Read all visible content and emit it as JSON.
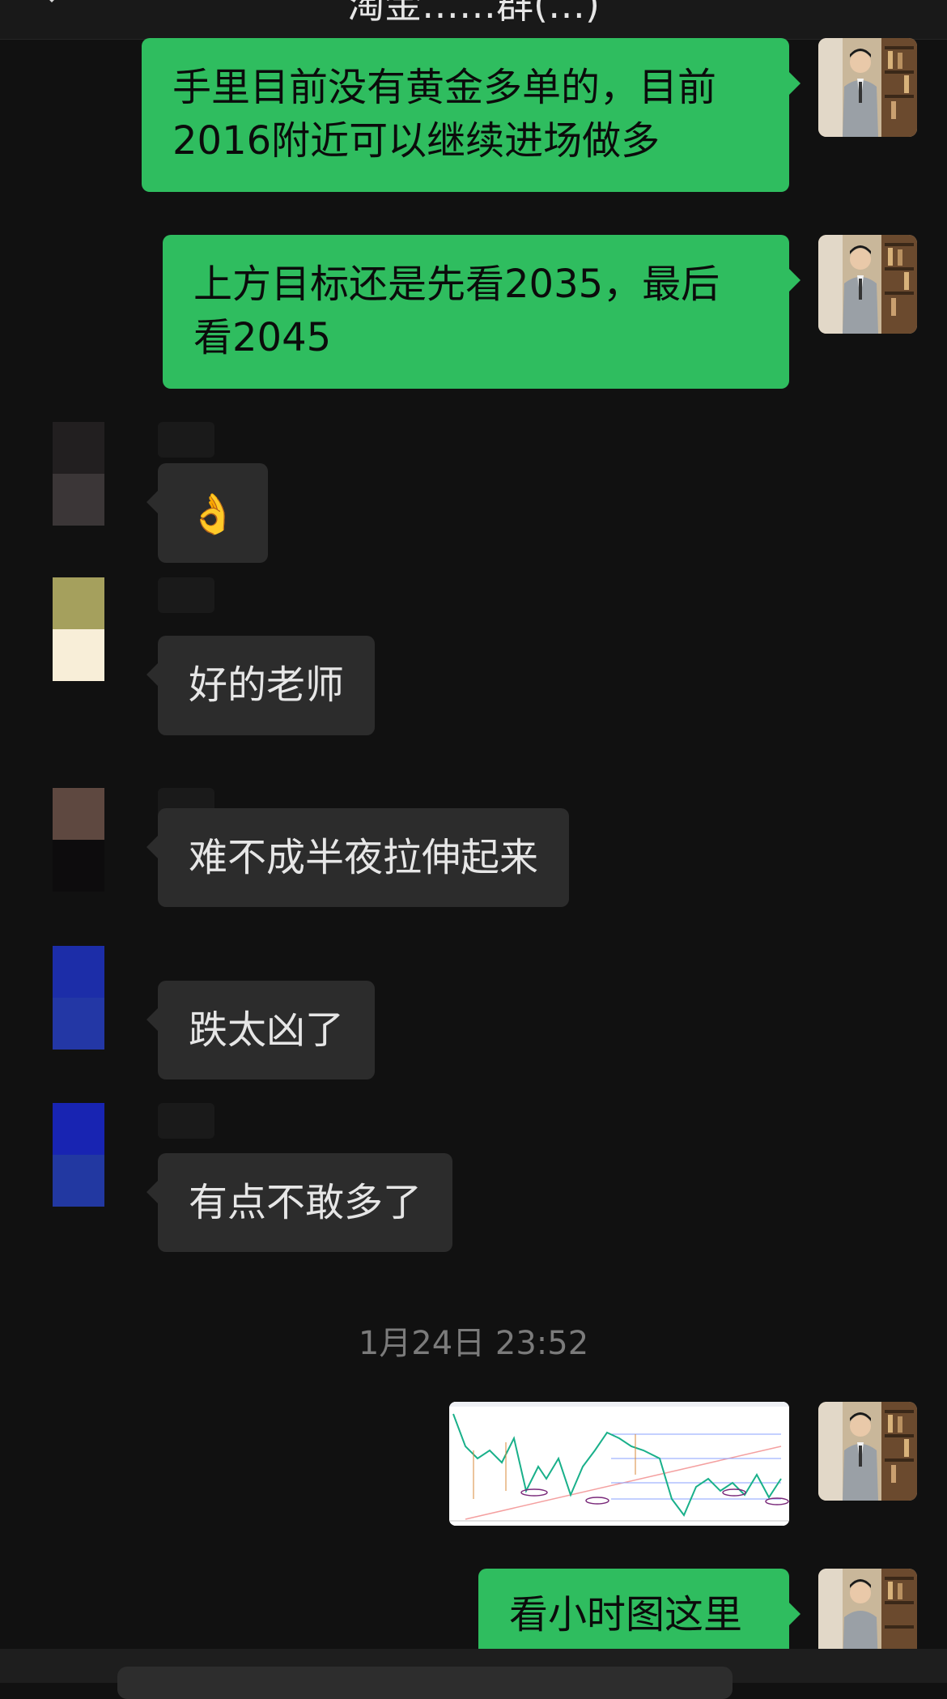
{
  "header": {
    "title": "淘金……群(…)"
  },
  "messages_out_top": [
    {
      "text": "手里目前没有黄金多单的，目前2016附近可以继续进场做多"
    },
    {
      "text": "上方目标还是先看2035，最后看2045"
    }
  ],
  "messages_in": [
    {
      "text": "👌"
    },
    {
      "text": "好的老师"
    },
    {
      "text": "难不成半夜拉伸起来"
    },
    {
      "text": "跌太凶了"
    },
    {
      "text": "有点不敢多了"
    }
  ],
  "timestamp": "1月24日 23:52",
  "message_last": {
    "text": "看小时图这里"
  },
  "colors": {
    "background": "#111111",
    "outgoing_bubble": "#2fbd5f",
    "incoming_bubble": "#2c2c2c",
    "avatar_1_top": "#221f20",
    "avatar_1_bottom": "#3b3637",
    "avatar_2_top": "#a5a05d",
    "avatar_2_bottom": "#f8eed8",
    "avatar_3_top": "#5e4840",
    "avatar_3_bottom": "#0d0c0d",
    "avatar_4_top": "#1c2da8",
    "avatar_4_bottom": "#2337a5",
    "avatar_5_top": "#1824b2",
    "avatar_5_bottom": "#2238a1"
  }
}
